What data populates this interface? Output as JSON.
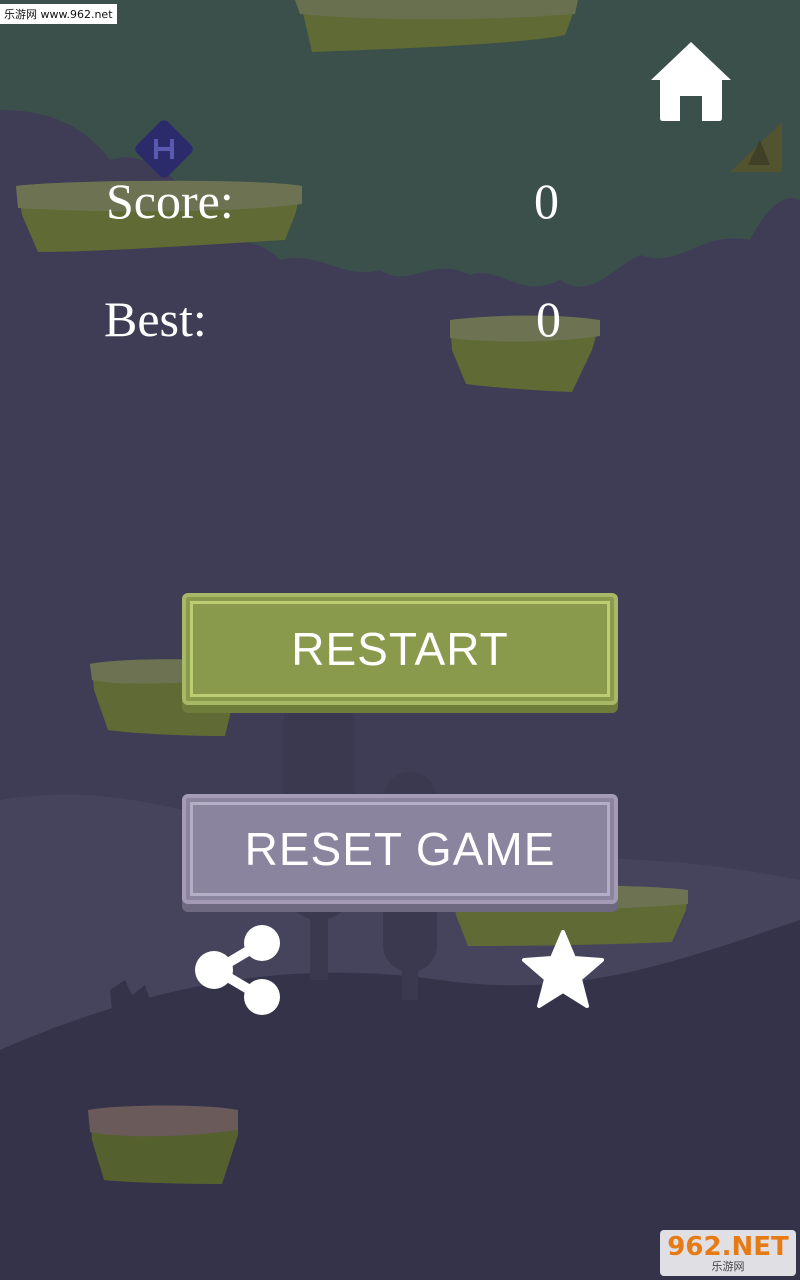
{
  "watermark_top": "乐游网 www.962.net",
  "scoreboard": {
    "score_label": "Score:",
    "score_value": "0",
    "best_label": "Best:",
    "best_value": "0"
  },
  "buttons": {
    "restart_label": "RESTART",
    "reset_label": "RESET GAME"
  },
  "icons": {
    "home": "home-icon",
    "share": "share-icon",
    "rate": "star-icon"
  },
  "watermark_bottom": {
    "logo": "962.NET",
    "subtitle": "乐游网"
  },
  "colors": {
    "background": "#3e3d55",
    "sky": "#3b4f4b",
    "restart": "#8a9a4c",
    "reset": "#8b849e"
  }
}
